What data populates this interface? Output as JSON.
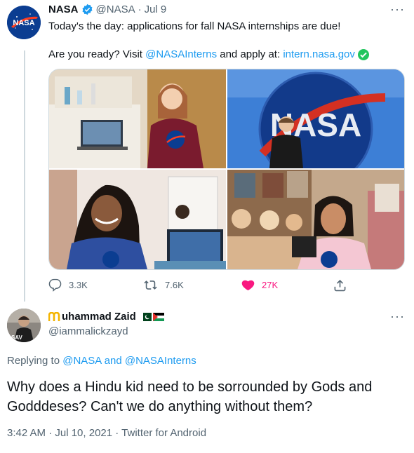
{
  "tweet": {
    "author_name": "NASA",
    "handle": "@NASA",
    "separator": "·",
    "date": "Jul 9",
    "line1": "Today's the day: applications for fall NASA internships are due!",
    "line2_prefix": "Are you ready? Visit ",
    "mention": "@NASAInterns",
    "line2_mid": " and apply at: ",
    "url": "intern.nasa.gov",
    "avatar_text": "NASA",
    "reply_count": "3.3K",
    "retweet_count": "7.6K",
    "like_count": "27K",
    "colors": {
      "like": "#f91880",
      "link": "#1d9bf0",
      "verified": "#1d9bf0"
    }
  },
  "reply": {
    "author_name": "uhammad Zaid",
    "handle": "@iammalickzayd",
    "replying_prefix": "Replying to ",
    "replying_user1": "@NASA",
    "replying_and": " and ",
    "replying_user2": "@NASAInterns",
    "text": "Why does a Hindu kid need to be sorrounded by Gods and Godddeses? Can't we do anything without them?",
    "timestamp": "3:42 AM · Jul 10, 2021 · Twitter for Android",
    "avatar_text": "SAV"
  }
}
